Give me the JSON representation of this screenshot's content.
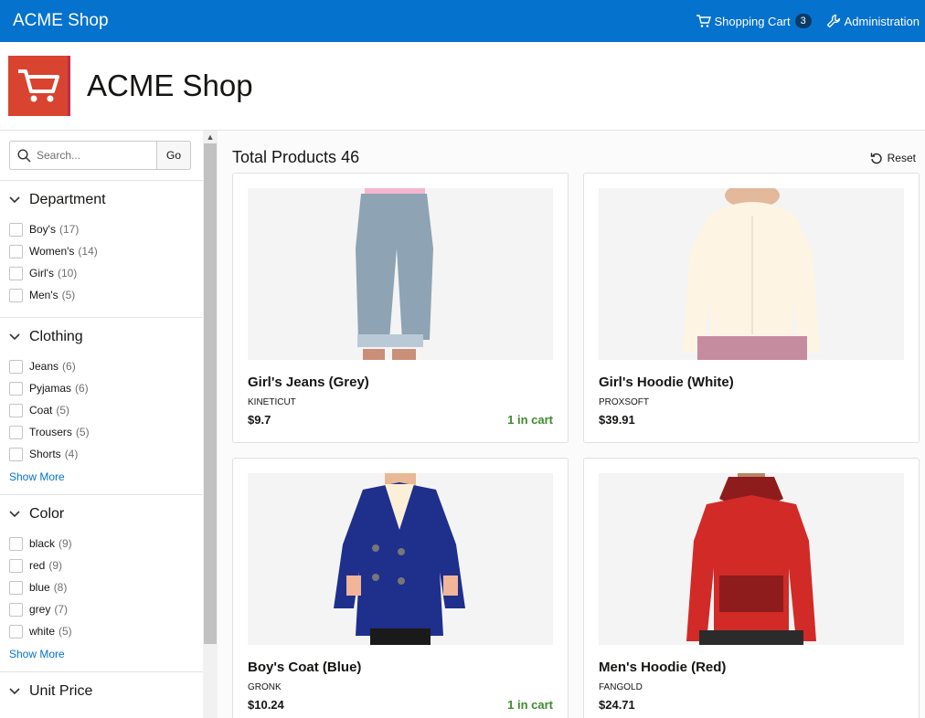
{
  "topbar": {
    "brand": "ACME Shop",
    "cart_label": "Shopping Cart",
    "cart_count": "3",
    "admin_label": "Administration",
    "color": "#0572ce"
  },
  "hero": {
    "title": "ACME Shop"
  },
  "search": {
    "placeholder": "Search...",
    "go_label": "Go"
  },
  "facets": [
    {
      "title": "Department",
      "options": [
        {
          "label": "Boy's",
          "count": "(17)"
        },
        {
          "label": "Women's",
          "count": "(14)"
        },
        {
          "label": "Girl's",
          "count": "(10)"
        },
        {
          "label": "Men's",
          "count": "(5)"
        }
      ]
    },
    {
      "title": "Clothing",
      "options": [
        {
          "label": "Jeans",
          "count": "(6)"
        },
        {
          "label": "Pyjamas",
          "count": "(6)"
        },
        {
          "label": "Coat",
          "count": "(5)"
        },
        {
          "label": "Trousers",
          "count": "(5)"
        },
        {
          "label": "Shorts",
          "count": "(4)"
        }
      ],
      "show_more": "Show More"
    },
    {
      "title": "Color",
      "options": [
        {
          "label": "black",
          "count": "(9)"
        },
        {
          "label": "red",
          "count": "(9)"
        },
        {
          "label": "blue",
          "count": "(8)"
        },
        {
          "label": "grey",
          "count": "(7)"
        },
        {
          "label": "white",
          "count": "(5)"
        }
      ],
      "show_more": "Show More"
    },
    {
      "title": "Unit Price",
      "options": []
    }
  ],
  "main": {
    "total_label": "Total Products",
    "total_count": "46",
    "reset_label": "Reset"
  },
  "products": [
    {
      "name": "Girl's Jeans (Grey)",
      "brand": "KINETICUT",
      "price": "$9.7",
      "in_cart": "1 in cart",
      "image": "grey-jeans"
    },
    {
      "name": "Girl's Hoodie (White)",
      "brand": "PROXSOFT",
      "price": "$39.91",
      "in_cart": "",
      "image": "white-hoodie"
    },
    {
      "name": "Boy's Coat (Blue)",
      "brand": "GRONK",
      "price": "$10.24",
      "in_cart": "1 in cart",
      "image": "blue-coat"
    },
    {
      "name": "Men's Hoodie (Red)",
      "brand": "FANGOLD",
      "price": "$24.71",
      "in_cart": "",
      "image": "red-hoodie"
    }
  ]
}
